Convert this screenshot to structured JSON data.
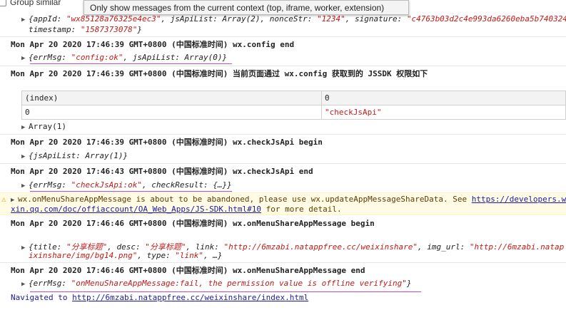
{
  "toolbar": {
    "group_similar_label": "Group similar",
    "tooltip": "Only show messages from the current context (top, iframe, worker, extension)"
  },
  "config_obj": {
    "line1_prefix": "{appId: ",
    "appId": "\"wx85128a76325e4ec3\"",
    "jsApiList_txt": ", jsApiList: Array(2), nonceStr: ",
    "nonceStr": "\"1234\"",
    "sig_txt": ", signature: ",
    "signature": "\"c4763b03d2c4e993da6260eba5b740324",
    "ts_txt": "timestamp: ",
    "timestamp": "\"1587373078\"",
    "close": "}"
  },
  "logs": [
    {
      "header": "Mon Apr 20 2020 17:46:39 GMT+0800 (中国标准时间) wx.config end"
    },
    {
      "header": "Mon Apr 20 2020 17:46:39 GMT+0800 (中国标准时间) 当前页面通过 wx.config 获取到的 JSSDK 权限如下"
    },
    {
      "header": "Mon Apr 20 2020 17:46:39 GMT+0800 (中国标准时间) wx.checkJsApi begin"
    },
    {
      "header": "Mon Apr 20 2020 17:46:43 GMT+0800 (中国标准时间) wx.checkJsApi end"
    },
    {
      "header": "Mon Apr 20 2020 17:46:46 GMT+0800 (中国标准时间) wx.onMenuShareAppMessage begin"
    },
    {
      "header": "Mon Apr 20 2020 17:46:46 GMT+0800 (中国标准时间) wx.onMenuShareAppMessage end"
    }
  ],
  "config_end": {
    "open": "{errMsg: ",
    "msg": "\"config:ok\"",
    "rest": ", jsApiList: Array(0)}"
  },
  "table": {
    "headers": [
      "(index)",
      "0"
    ],
    "rows": [
      [
        "0",
        "\"checkJsApi\""
      ]
    ],
    "array_label": "Array(1)"
  },
  "check_begin": {
    "text": "{jsApiList: Array(1)}"
  },
  "check_end": {
    "open": "{errMsg: ",
    "msg": "\"checkJsApi:ok\"",
    "rest": ", checkResult: {…}}"
  },
  "warning": {
    "line1": "wx.onMenuShareAppMessage is about to be abandoned, please use wx.updateAppMessageShareData. See ",
    "link1": "https://developers.w",
    "link2": "xin.qq.com/doc/offiaccount/OA_Web_Apps/JS-SDK.html#10",
    "line2_rest": " for more detail."
  },
  "share_begin": {
    "t1": "{title: ",
    "title": "\"分享标题\"",
    "t2": ", desc: ",
    "desc": "\"分享标题\"",
    "t3": ", link: ",
    "link": "\"http://6mzabi.natappfree.cc/weixinshare\"",
    "t4": ", img_url: ",
    "img_url": "\"http://6mzabi.natap",
    "img_url2": "ixinshare/img/bg14.png\"",
    "t5": ", type: ",
    "type": "\"link\"",
    "t6": ", …}"
  },
  "share_end": {
    "open": "{errMsg: ",
    "msg": "\"onMenuShareAppMessage:fail, the permission value is offline verifying\"",
    "close": "}"
  },
  "navigated": {
    "label": "Navigated to ",
    "url": "http://6mzabi.natappfree.cc/weixinshare/index.html"
  },
  "colors": {
    "string": "#c41a16",
    "link": "#1a1aa6",
    "warning_bg": "#fffbe5",
    "underline": "#c44ac4"
  }
}
